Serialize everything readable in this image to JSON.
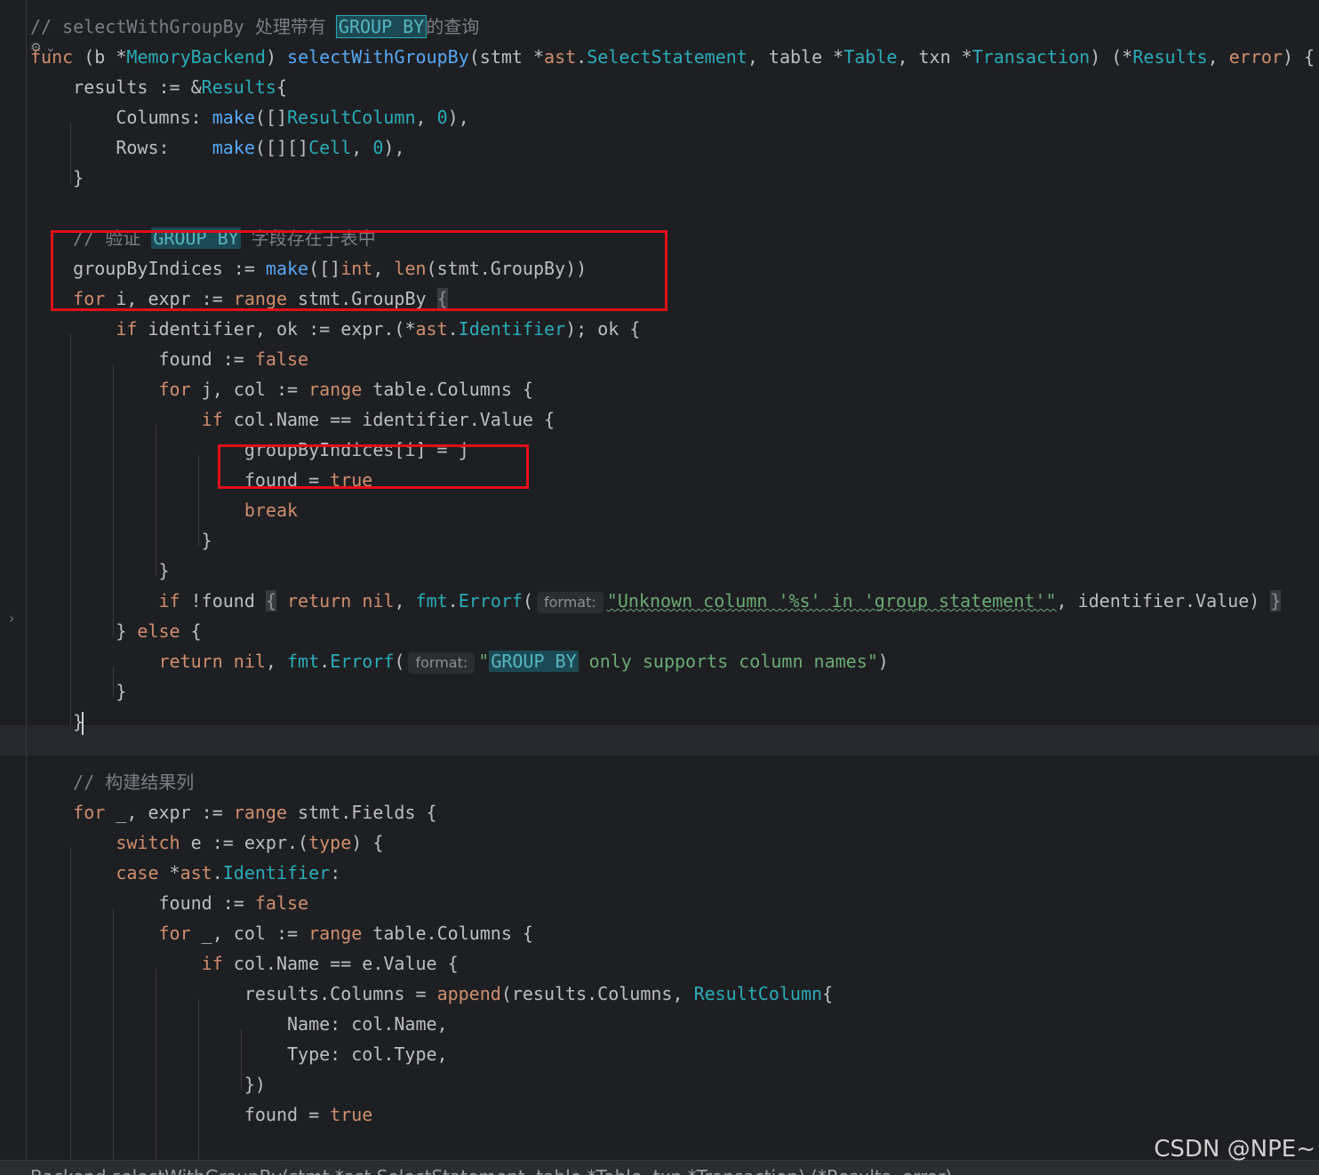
{
  "editor": {
    "lines": [
      {
        "segments": [
          {
            "t": "// selectWithGroupBy 处理带有 ",
            "c": "cmt"
          },
          {
            "t": "GROUP BY",
            "c": "hl hl-box"
          },
          {
            "t": "的查询",
            "c": "cmt"
          }
        ]
      },
      {
        "segments": [
          {
            "t": "func",
            "c": "kw"
          },
          {
            "t": " (",
            "c": ""
          },
          {
            "t": "b",
            "c": ""
          },
          {
            "t": " *",
            "c": ""
          },
          {
            "t": "MemoryBackend",
            "c": "ty"
          },
          {
            "t": ") ",
            "c": ""
          },
          {
            "t": "selectWithGroupBy",
            "c": "fn"
          },
          {
            "t": "(stmt *",
            "c": ""
          },
          {
            "t": "ast",
            "c": "kw"
          },
          {
            "t": ".",
            "c": ""
          },
          {
            "t": "SelectStatement",
            "c": "ty"
          },
          {
            "t": ", table *",
            "c": ""
          },
          {
            "t": "Table",
            "c": "ty"
          },
          {
            "t": ", txn *",
            "c": ""
          },
          {
            "t": "Transaction",
            "c": "ty"
          },
          {
            "t": ") (*",
            "c": ""
          },
          {
            "t": "Results",
            "c": "ty"
          },
          {
            "t": ", ",
            "c": ""
          },
          {
            "t": "error",
            "c": "kw"
          },
          {
            "t": ") {",
            "c": ""
          }
        ]
      },
      {
        "segments": [
          {
            "t": "    results := &",
            "c": ""
          },
          {
            "t": "Results",
            "c": "ty"
          },
          {
            "t": "{",
            "c": ""
          }
        ]
      },
      {
        "segments": [
          {
            "t": "        Columns: ",
            "c": ""
          },
          {
            "t": "make",
            "c": "fn"
          },
          {
            "t": "([]",
            "c": ""
          },
          {
            "t": "ResultColumn",
            "c": "ty"
          },
          {
            "t": ", ",
            "c": ""
          },
          {
            "t": "0",
            "c": "num"
          },
          {
            "t": "),",
            "c": ""
          }
        ]
      },
      {
        "segments": [
          {
            "t": "        Rows:    ",
            "c": ""
          },
          {
            "t": "make",
            "c": "fn"
          },
          {
            "t": "([][]",
            "c": ""
          },
          {
            "t": "Cell",
            "c": "ty"
          },
          {
            "t": ", ",
            "c": ""
          },
          {
            "t": "0",
            "c": "num"
          },
          {
            "t": "),",
            "c": ""
          }
        ]
      },
      {
        "segments": [
          {
            "t": "    }",
            "c": ""
          }
        ]
      },
      {
        "segments": [
          {
            "t": "",
            "c": ""
          }
        ]
      },
      {
        "segments": [
          {
            "t": "    // 验证 ",
            "c": "cmt"
          },
          {
            "t": "GROUP BY",
            "c": "hl"
          },
          {
            "t": " 字段存在于表中",
            "c": "cmt"
          }
        ]
      },
      {
        "segments": [
          {
            "t": "    groupByIndices := ",
            "c": ""
          },
          {
            "t": "make",
            "c": "fn"
          },
          {
            "t": "([]",
            "c": ""
          },
          {
            "t": "int",
            "c": "kw"
          },
          {
            "t": ", ",
            "c": ""
          },
          {
            "t": "len",
            "c": "kw"
          },
          {
            "t": "(stmt.GroupBy))",
            "c": ""
          }
        ]
      },
      {
        "segments": [
          {
            "t": "    ",
            "c": ""
          },
          {
            "t": "for",
            "c": "kw"
          },
          {
            "t": " i, expr := ",
            "c": ""
          },
          {
            "t": "range",
            "c": "kw"
          },
          {
            "t": " stmt.GroupBy ",
            "c": ""
          },
          {
            "t": "{",
            "c": "fold-box"
          }
        ]
      },
      {
        "segments": [
          {
            "t": "        ",
            "c": ""
          },
          {
            "t": "if",
            "c": "kw"
          },
          {
            "t": " identifier, ok := expr.(*",
            "c": ""
          },
          {
            "t": "ast",
            "c": "kw"
          },
          {
            "t": ".",
            "c": ""
          },
          {
            "t": "Identifier",
            "c": "ty"
          },
          {
            "t": "); ok {",
            "c": ""
          }
        ]
      },
      {
        "segments": [
          {
            "t": "            found := ",
            "c": ""
          },
          {
            "t": "false",
            "c": "kw"
          }
        ]
      },
      {
        "segments": [
          {
            "t": "            ",
            "c": ""
          },
          {
            "t": "for",
            "c": "kw"
          },
          {
            "t": " j, col := ",
            "c": ""
          },
          {
            "t": "range",
            "c": "kw"
          },
          {
            "t": " table.Columns {",
            "c": ""
          }
        ]
      },
      {
        "segments": [
          {
            "t": "                ",
            "c": ""
          },
          {
            "t": "if",
            "c": "kw"
          },
          {
            "t": " col.Name == identifier.Value {",
            "c": ""
          }
        ]
      },
      {
        "segments": [
          {
            "t": "                    groupByIndices[i] = j",
            "c": ""
          }
        ]
      },
      {
        "segments": [
          {
            "t": "                    found = ",
            "c": ""
          },
          {
            "t": "true",
            "c": "kw"
          }
        ]
      },
      {
        "segments": [
          {
            "t": "                    ",
            "c": ""
          },
          {
            "t": "break",
            "c": "kw"
          }
        ]
      },
      {
        "segments": [
          {
            "t": "                }",
            "c": ""
          }
        ]
      },
      {
        "segments": [
          {
            "t": "            }",
            "c": ""
          }
        ]
      },
      {
        "segments": [
          {
            "t": "            ",
            "c": ""
          },
          {
            "t": "if",
            "c": "kw"
          },
          {
            "t": " !found ",
            "c": ""
          },
          {
            "t": "{",
            "c": "fold-box"
          },
          {
            "t": " ",
            "c": ""
          },
          {
            "t": "return",
            "c": "kw"
          },
          {
            "t": " ",
            "c": ""
          },
          {
            "t": "nil",
            "c": "kw"
          },
          {
            "t": ", ",
            "c": ""
          },
          {
            "t": "fmt",
            "c": "ty"
          },
          {
            "t": ".",
            "c": ""
          },
          {
            "t": "Errorf",
            "c": "ty"
          },
          {
            "t": "(",
            "c": ""
          },
          {
            "t": "format:",
            "c": "hint"
          },
          {
            "t": "\"Unknown column '%s' in 'group statement'\"",
            "c": "str squiggle"
          },
          {
            "t": ", identifier.Value) ",
            "c": ""
          },
          {
            "t": "}",
            "c": "fold-box"
          }
        ]
      },
      {
        "segments": [
          {
            "t": "        } ",
            "c": ""
          },
          {
            "t": "else",
            "c": "kw"
          },
          {
            "t": " {",
            "c": ""
          }
        ]
      },
      {
        "segments": [
          {
            "t": "            ",
            "c": ""
          },
          {
            "t": "return",
            "c": "kw"
          },
          {
            "t": " ",
            "c": ""
          },
          {
            "t": "nil",
            "c": "kw"
          },
          {
            "t": ", ",
            "c": ""
          },
          {
            "t": "fmt",
            "c": "ty"
          },
          {
            "t": ".",
            "c": ""
          },
          {
            "t": "Errorf",
            "c": "ty"
          },
          {
            "t": "(",
            "c": ""
          },
          {
            "t": "format:",
            "c": "hint"
          },
          {
            "t": "\"",
            "c": "str"
          },
          {
            "t": "GROUP BY",
            "c": "hl"
          },
          {
            "t": " only supports column names\"",
            "c": "str"
          },
          {
            "t": ")",
            "c": ""
          }
        ]
      },
      {
        "segments": [
          {
            "t": "        }",
            "c": ""
          }
        ]
      },
      {
        "segments": [
          {
            "t": "    }",
            "c": ""
          }
        ],
        "cursor": true
      },
      {
        "segments": [
          {
            "t": "",
            "c": ""
          }
        ]
      },
      {
        "segments": [
          {
            "t": "    // 构建结果列",
            "c": "cmt"
          }
        ]
      },
      {
        "segments": [
          {
            "t": "    ",
            "c": ""
          },
          {
            "t": "for",
            "c": "kw"
          },
          {
            "t": " _, expr := ",
            "c": ""
          },
          {
            "t": "range",
            "c": "kw"
          },
          {
            "t": " stmt.Fields {",
            "c": ""
          }
        ]
      },
      {
        "segments": [
          {
            "t": "        ",
            "c": ""
          },
          {
            "t": "switch",
            "c": "kw"
          },
          {
            "t": " e := expr.(",
            "c": ""
          },
          {
            "t": "type",
            "c": "kw"
          },
          {
            "t": ") {",
            "c": ""
          }
        ]
      },
      {
        "segments": [
          {
            "t": "        ",
            "c": ""
          },
          {
            "t": "case",
            "c": "kw"
          },
          {
            "t": " *",
            "c": ""
          },
          {
            "t": "ast",
            "c": "kw"
          },
          {
            "t": ".",
            "c": ""
          },
          {
            "t": "Identifier",
            "c": "ty"
          },
          {
            "t": ":",
            "c": ""
          }
        ]
      },
      {
        "segments": [
          {
            "t": "            found := ",
            "c": ""
          },
          {
            "t": "false",
            "c": "kw"
          }
        ]
      },
      {
        "segments": [
          {
            "t": "            ",
            "c": ""
          },
          {
            "t": "for",
            "c": "kw"
          },
          {
            "t": " _, col := ",
            "c": ""
          },
          {
            "t": "range",
            "c": "kw"
          },
          {
            "t": " table.Columns {",
            "c": ""
          }
        ]
      },
      {
        "segments": [
          {
            "t": "                ",
            "c": ""
          },
          {
            "t": "if",
            "c": "kw"
          },
          {
            "t": " col.Name == e.Value {",
            "c": ""
          }
        ]
      },
      {
        "segments": [
          {
            "t": "                    results.Columns = ",
            "c": ""
          },
          {
            "t": "append",
            "c": "kw"
          },
          {
            "t": "(results.Columns, ",
            "c": ""
          },
          {
            "t": "ResultColumn",
            "c": "ty"
          },
          {
            "t": "{",
            "c": ""
          }
        ]
      },
      {
        "segments": [
          {
            "t": "                        Name: col.Name,",
            "c": ""
          }
        ]
      },
      {
        "segments": [
          {
            "t": "                        Type: col.Type,",
            "c": ""
          }
        ]
      },
      {
        "segments": [
          {
            "t": "                    })",
            "c": ""
          }
        ]
      },
      {
        "segments": [
          {
            "t": "                    found = ",
            "c": ""
          },
          {
            "t": "true",
            "c": "kw"
          }
        ]
      }
    ]
  },
  "breadcrumb": "Backend.selectWithGroupBy(stmt *ast.SelectStatement, table *Table, txn *Transaction) (*Results, error)",
  "watermark": "CSDN @NPE~",
  "author_icon": "⚙ ⌄",
  "colors": {
    "highlight_box": "#e0101a",
    "background": "#1e1f22"
  }
}
